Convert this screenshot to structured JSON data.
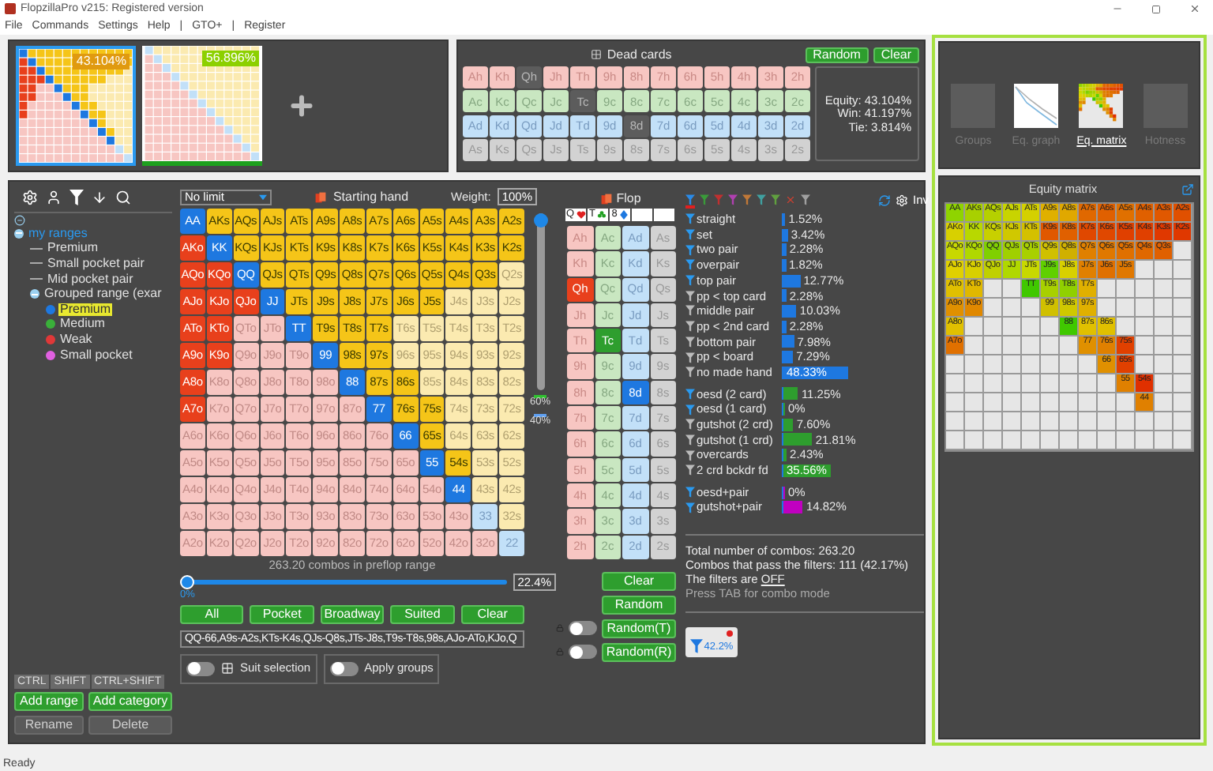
{
  "window": {
    "title": "FlopzillaPro v215: Registered version"
  },
  "menu": [
    "File",
    "Commands",
    "Settings",
    "Help",
    "|",
    "GTO+",
    "|",
    "Register"
  ],
  "ranges": [
    {
      "equity": "43.104%",
      "selected": true,
      "color": "#e09a10"
    },
    {
      "equity": "56.896%",
      "selected": false,
      "color": "#8cd000"
    }
  ],
  "dead_cards": {
    "title": "Dead cards",
    "buttons": [
      "Random",
      "Clear"
    ],
    "rows": [
      [
        {
          "label": "Ah",
          "disabled": false
        },
        {
          "label": "Kh",
          "disabled": false
        },
        {
          "label": "Qh",
          "disabled": true
        },
        {
          "label": "Jh",
          "disabled": false
        },
        {
          "label": "Th",
          "disabled": false
        },
        {
          "label": "9h",
          "disabled": false
        },
        {
          "label": "8h",
          "disabled": false
        },
        {
          "label": "7h",
          "disabled": false
        },
        {
          "label": "6h",
          "disabled": false
        },
        {
          "label": "5h",
          "disabled": false
        },
        {
          "label": "4h",
          "disabled": false
        },
        {
          "label": "3h",
          "disabled": false
        },
        {
          "label": "2h",
          "disabled": false
        }
      ],
      [
        {
          "label": "Ac",
          "disabled": false
        },
        {
          "label": "Kc",
          "disabled": false
        },
        {
          "label": "Qc",
          "disabled": false
        },
        {
          "label": "Jc",
          "disabled": false
        },
        {
          "label": "Tc",
          "disabled": true
        },
        {
          "label": "9c",
          "disabled": false
        },
        {
          "label": "8c",
          "disabled": false
        },
        {
          "label": "7c",
          "disabled": false
        },
        {
          "label": "6c",
          "disabled": false
        },
        {
          "label": "5c",
          "disabled": false
        },
        {
          "label": "4c",
          "disabled": false
        },
        {
          "label": "3c",
          "disabled": false
        },
        {
          "label": "2c",
          "disabled": false
        }
      ],
      [
        {
          "label": "Ad",
          "disabled": false
        },
        {
          "label": "Kd",
          "disabled": false
        },
        {
          "label": "Qd",
          "disabled": false
        },
        {
          "label": "Jd",
          "disabled": false
        },
        {
          "label": "Td",
          "disabled": false
        },
        {
          "label": "9d",
          "disabled": false
        },
        {
          "label": "8d",
          "disabled": true
        },
        {
          "label": "7d",
          "disabled": false
        },
        {
          "label": "6d",
          "disabled": false
        },
        {
          "label": "5d",
          "disabled": false
        },
        {
          "label": "4d",
          "disabled": false
        },
        {
          "label": "3d",
          "disabled": false
        },
        {
          "label": "2d",
          "disabled": false
        }
      ],
      [
        {
          "label": "As",
          "disabled": false
        },
        {
          "label": "Ks",
          "disabled": false
        },
        {
          "label": "Qs",
          "disabled": false
        },
        {
          "label": "Js",
          "disabled": false
        },
        {
          "label": "Ts",
          "disabled": false
        },
        {
          "label": "9s",
          "disabled": false
        },
        {
          "label": "8s",
          "disabled": false
        },
        {
          "label": "7s",
          "disabled": false
        },
        {
          "label": "6s",
          "disabled": false
        },
        {
          "label": "5s",
          "disabled": false
        },
        {
          "label": "4s",
          "disabled": false
        },
        {
          "label": "3s",
          "disabled": false
        },
        {
          "label": "2s",
          "disabled": false
        }
      ]
    ],
    "equity": [
      "Equity: 43.104%",
      "Win: 41.197%",
      "Tie: 3.814%"
    ]
  },
  "views": [
    {
      "label": "Groups",
      "selected": false,
      "kind": "empty"
    },
    {
      "label": "Eq. graph",
      "selected": false,
      "kind": "graph"
    },
    {
      "label": "Eq. matrix",
      "selected": true,
      "kind": "matrix"
    },
    {
      "label": "Hotness",
      "selected": false,
      "kind": "empty"
    }
  ],
  "tree": [
    {
      "label": "my ranges",
      "expanded": true,
      "selected": false,
      "children": [
        {
          "label": "Premium",
          "selected": false
        },
        {
          "label": "Small pocket pair",
          "selected": false
        },
        {
          "label": "Mid pocket pair",
          "selected": false
        },
        {
          "label": "Grouped range (exar",
          "expanded": true,
          "selected": false,
          "children": [
            {
              "label": "Premium",
              "selected": true,
              "color": "#1e78e0"
            },
            {
              "label": "Medium",
              "selected": false,
              "color": "#3ab03a"
            },
            {
              "label": "Weak",
              "selected": false,
              "color": "#e03838"
            },
            {
              "label": "Small pocket",
              "selected": false,
              "color": "#e060e0"
            }
          ]
        }
      ]
    }
  ],
  "modifier_tabs": [
    {
      "label": "CTRL",
      "selected": false
    },
    {
      "label": "SHIFT",
      "selected": false
    },
    {
      "label": "CTRL+SHIFT",
      "selected": false
    }
  ],
  "tree_buttons": [
    {
      "label": "Add range",
      "disabled": false
    },
    {
      "label": "Add category",
      "disabled": false
    },
    {
      "label": "Rename",
      "disabled": true
    },
    {
      "label": "Delete",
      "disabled": true
    }
  ],
  "range_editor": {
    "game": "No limit",
    "title": "Starting hand",
    "weight_label": "Weight:",
    "weight": "100%",
    "weight_slider": {
      "level": 1
    },
    "legend": [
      "60%",
      "40%"
    ],
    "grid": [
      {
        "cells": [
          {
            "label": "AA",
            "selected": true
          },
          {
            "label": "AKs",
            "selected": true
          },
          {
            "label": "AQs",
            "selected": true
          },
          {
            "label": "AJs",
            "selected": true
          },
          {
            "label": "ATs",
            "selected": true
          },
          {
            "label": "A9s",
            "selected": true
          },
          {
            "label": "A8s",
            "selected": true
          },
          {
            "label": "A7s",
            "selected": true
          },
          {
            "label": "A6s",
            "selected": true
          },
          {
            "label": "A5s",
            "selected": true
          },
          {
            "label": "A4s",
            "selected": true
          },
          {
            "label": "A3s",
            "selected": true
          },
          {
            "label": "A2s",
            "selected": true
          }
        ]
      },
      {
        "cells": [
          {
            "label": "AKo",
            "selected": true
          },
          {
            "label": "KK",
            "selected": true
          },
          {
            "label": "KQs",
            "selected": true
          },
          {
            "label": "KJs",
            "selected": true
          },
          {
            "label": "KTs",
            "selected": true
          },
          {
            "label": "K9s",
            "selected": true
          },
          {
            "label": "K8s",
            "selected": true
          },
          {
            "label": "K7s",
            "selected": true
          },
          {
            "label": "K6s",
            "selected": true
          },
          {
            "label": "K5s",
            "selected": true
          },
          {
            "label": "K4s",
            "selected": true
          },
          {
            "label": "K3s",
            "selected": true
          },
          {
            "label": "K2s",
            "selected": true
          }
        ]
      },
      {
        "cells": [
          {
            "label": "AQo",
            "selected": true
          },
          {
            "label": "KQo",
            "selected": true
          },
          {
            "label": "QQ",
            "selected": true
          },
          {
            "label": "QJs",
            "selected": true
          },
          {
            "label": "QTs",
            "selected": true
          },
          {
            "label": "Q9s",
            "selected": true
          },
          {
            "label": "Q8s",
            "selected": true
          },
          {
            "label": "Q7s",
            "selected": true
          },
          {
            "label": "Q6s",
            "selected": true
          },
          {
            "label": "Q5s",
            "selected": true
          },
          {
            "label": "Q4s",
            "selected": true
          },
          {
            "label": "Q3s",
            "selected": true
          },
          {
            "label": "Q2s",
            "selected": false
          }
        ]
      },
      {
        "cells": [
          {
            "label": "AJo",
            "selected": true
          },
          {
            "label": "KJo",
            "selected": true
          },
          {
            "label": "QJo",
            "selected": true
          },
          {
            "label": "JJ",
            "selected": true
          },
          {
            "label": "JTs",
            "selected": true
          },
          {
            "label": "J9s",
            "selected": true
          },
          {
            "label": "J8s",
            "selected": true
          },
          {
            "label": "J7s",
            "selected": true
          },
          {
            "label": "J6s",
            "selected": true
          },
          {
            "label": "J5s",
            "selected": true
          },
          {
            "label": "J4s",
            "selected": false
          },
          {
            "label": "J3s",
            "selected": false
          },
          {
            "label": "J2s",
            "selected": false
          }
        ]
      },
      {
        "cells": [
          {
            "label": "ATo",
            "selected": true
          },
          {
            "label": "KTo",
            "selected": true
          },
          {
            "label": "QTo",
            "selected": false
          },
          {
            "label": "JTo",
            "selected": false
          },
          {
            "label": "TT",
            "selected": true
          },
          {
            "label": "T9s",
            "selected": true
          },
          {
            "label": "T8s",
            "selected": true
          },
          {
            "label": "T7s",
            "selected": true
          },
          {
            "label": "T6s",
            "selected": false
          },
          {
            "label": "T5s",
            "selected": false
          },
          {
            "label": "T4s",
            "selected": false
          },
          {
            "label": "T3s",
            "selected": false
          },
          {
            "label": "T2s",
            "selected": false
          }
        ]
      },
      {
        "cells": [
          {
            "label": "A9o",
            "selected": true
          },
          {
            "label": "K9o",
            "selected": true
          },
          {
            "label": "Q9o",
            "selected": false
          },
          {
            "label": "J9o",
            "selected": false
          },
          {
            "label": "T9o",
            "selected": false
          },
          {
            "label": "99",
            "selected": true
          },
          {
            "label": "98s",
            "selected": true
          },
          {
            "label": "97s",
            "selected": true
          },
          {
            "label": "96s",
            "selected": false
          },
          {
            "label": "95s",
            "selected": false
          },
          {
            "label": "94s",
            "selected": false
          },
          {
            "label": "93s",
            "selected": false
          },
          {
            "label": "92s",
            "selected": false
          }
        ]
      },
      {
        "cells": [
          {
            "label": "A8o",
            "selected": true
          },
          {
            "label": "K8o",
            "selected": false
          },
          {
            "label": "Q8o",
            "selected": false
          },
          {
            "label": "J8o",
            "selected": false
          },
          {
            "label": "T8o",
            "selected": false
          },
          {
            "label": "98o",
            "selected": false
          },
          {
            "label": "88",
            "selected": true
          },
          {
            "label": "87s",
            "selected": true
          },
          {
            "label": "86s",
            "selected": true
          },
          {
            "label": "85s",
            "selected": false
          },
          {
            "label": "84s",
            "selected": false
          },
          {
            "label": "83s",
            "selected": false
          },
          {
            "label": "82s",
            "selected": false
          }
        ]
      },
      {
        "cells": [
          {
            "label": "A7o",
            "selected": true
          },
          {
            "label": "K7o",
            "selected": false
          },
          {
            "label": "Q7o",
            "selected": false
          },
          {
            "label": "J7o",
            "selected": false
          },
          {
            "label": "T7o",
            "selected": false
          },
          {
            "label": "97o",
            "selected": false
          },
          {
            "label": "87o",
            "selected": false
          },
          {
            "label": "77",
            "selected": true
          },
          {
            "label": "76s",
            "selected": true
          },
          {
            "label": "75s",
            "selected": true
          },
          {
            "label": "74s",
            "selected": false
          },
          {
            "label": "73s",
            "selected": false
          },
          {
            "label": "72s",
            "selected": false
          }
        ]
      },
      {
        "cells": [
          {
            "label": "A6o",
            "selected": false
          },
          {
            "label": "K6o",
            "selected": false
          },
          {
            "label": "Q6o",
            "selected": false
          },
          {
            "label": "J6o",
            "selected": false
          },
          {
            "label": "T6o",
            "selected": false
          },
          {
            "label": "96o",
            "selected": false
          },
          {
            "label": "86o",
            "selected": false
          },
          {
            "label": "76o",
            "selected": false
          },
          {
            "label": "66",
            "selected": true
          },
          {
            "label": "65s",
            "selected": true
          },
          {
            "label": "64s",
            "selected": false
          },
          {
            "label": "63s",
            "selected": false
          },
          {
            "label": "62s",
            "selected": false
          }
        ]
      },
      {
        "cells": [
          {
            "label": "A5o",
            "selected": false
          },
          {
            "label": "K5o",
            "selected": false
          },
          {
            "label": "Q5o",
            "selected": false
          },
          {
            "label": "J5o",
            "selected": false
          },
          {
            "label": "T5o",
            "selected": false
          },
          {
            "label": "95o",
            "selected": false
          },
          {
            "label": "85o",
            "selected": false
          },
          {
            "label": "75o",
            "selected": false
          },
          {
            "label": "65o",
            "selected": false
          },
          {
            "label": "55",
            "selected": true
          },
          {
            "label": "54s",
            "selected": true
          },
          {
            "label": "53s",
            "selected": false
          },
          {
            "label": "52s",
            "selected": false
          }
        ]
      },
      {
        "cells": [
          {
            "label": "A4o",
            "selected": false
          },
          {
            "label": "K4o",
            "selected": false
          },
          {
            "label": "Q4o",
            "selected": false
          },
          {
            "label": "J4o",
            "selected": false
          },
          {
            "label": "T4o",
            "selected": false
          },
          {
            "label": "94o",
            "selected": false
          },
          {
            "label": "84o",
            "selected": false
          },
          {
            "label": "74o",
            "selected": false
          },
          {
            "label": "64o",
            "selected": false
          },
          {
            "label": "54o",
            "selected": false
          },
          {
            "label": "44",
            "selected": true
          },
          {
            "label": "43s",
            "selected": false
          },
          {
            "label": "42s",
            "selected": false
          }
        ]
      },
      {
        "cells": [
          {
            "label": "A3o",
            "selected": false
          },
          {
            "label": "K3o",
            "selected": false
          },
          {
            "label": "Q3o",
            "selected": false
          },
          {
            "label": "J3o",
            "selected": false
          },
          {
            "label": "T3o",
            "selected": false
          },
          {
            "label": "93o",
            "selected": false
          },
          {
            "label": "83o",
            "selected": false
          },
          {
            "label": "73o",
            "selected": false
          },
          {
            "label": "63o",
            "selected": false
          },
          {
            "label": "53o",
            "selected": false
          },
          {
            "label": "43o",
            "selected": false
          },
          {
            "label": "33",
            "selected": false
          },
          {
            "label": "32s",
            "selected": false
          }
        ]
      },
      {
        "cells": [
          {
            "label": "A2o",
            "selected": false
          },
          {
            "label": "K2o",
            "selected": false
          },
          {
            "label": "Q2o",
            "selected": false
          },
          {
            "label": "J2o",
            "selected": false
          },
          {
            "label": "T2o",
            "selected": false
          },
          {
            "label": "92o",
            "selected": false
          },
          {
            "label": "82o",
            "selected": false
          },
          {
            "label": "72o",
            "selected": false
          },
          {
            "label": "62o",
            "selected": false
          },
          {
            "label": "52o",
            "selected": false
          },
          {
            "label": "42o",
            "selected": false
          },
          {
            "label": "32o",
            "selected": false
          },
          {
            "label": "22",
            "selected": false
          }
        ]
      }
    ],
    "combos": "263.20 combos in preflop range",
    "range_slider": {
      "level": 0,
      "min_label": "0%",
      "value": "22.4%"
    },
    "buttons": [
      "All",
      "Pocket",
      "Broadway",
      "Suited",
      "Clear"
    ],
    "range_text": "QQ-66,A9s-A2s,KTs-K4s,QJs-Q8s,JTs-J8s,T9s-T8s,98s,AJo-ATo,KJo,Q",
    "toggles": [
      {
        "label": "Suit selection",
        "on": false,
        "kind": "suits"
      },
      {
        "label": "Apply groups",
        "on": false,
        "kind": "plain"
      }
    ]
  },
  "flop": {
    "title": "Flop",
    "board": [
      {
        "kind": "heart",
        "rank": "Q"
      },
      {
        "kind": "club",
        "rank": "T"
      },
      {
        "kind": "diamond",
        "rank": "8"
      },
      {
        "kind": "empty"
      },
      {
        "kind": "empty"
      }
    ],
    "rows": [
      [
        {
          "label": "Ah",
          "selected": false
        },
        {
          "label": "Ac",
          "selected": false
        },
        {
          "label": "Ad",
          "selected": false
        },
        {
          "label": "As",
          "selected": false
        }
      ],
      [
        {
          "label": "Kh",
          "selected": false
        },
        {
          "label": "Kc",
          "selected": false
        },
        {
          "label": "Kd",
          "selected": false
        },
        {
          "label": "Ks",
          "selected": false
        }
      ],
      [
        {
          "label": "Qh",
          "selected": true
        },
        {
          "label": "Qc",
          "selected": false
        },
        {
          "label": "Qd",
          "selected": false
        },
        {
          "label": "Qs",
          "selected": false
        }
      ],
      [
        {
          "label": "Jh",
          "selected": false
        },
        {
          "label": "Jc",
          "selected": false
        },
        {
          "label": "Jd",
          "selected": false
        },
        {
          "label": "Js",
          "selected": false
        }
      ],
      [
        {
          "label": "Th",
          "selected": false
        },
        {
          "label": "Tc",
          "selected": true
        },
        {
          "label": "Td",
          "selected": false
        },
        {
          "label": "Ts",
          "selected": false
        }
      ],
      [
        {
          "label": "9h",
          "selected": false
        },
        {
          "label": "9c",
          "selected": false
        },
        {
          "label": "9d",
          "selected": false
        },
        {
          "label": "9s",
          "selected": false
        }
      ],
      [
        {
          "label": "8h",
          "selected": false
        },
        {
          "label": "8c",
          "selected": false
        },
        {
          "label": "8d",
          "selected": true
        },
        {
          "label": "8s",
          "selected": false
        }
      ],
      [
        {
          "label": "7h",
          "selected": false
        },
        {
          "label": "7c",
          "selected": false
        },
        {
          "label": "7d",
          "selected": false
        },
        {
          "label": "7s",
          "selected": false
        }
      ],
      [
        {
          "label": "6h",
          "selected": false
        },
        {
          "label": "6c",
          "selected": false
        },
        {
          "label": "6d",
          "selected": false
        },
        {
          "label": "6s",
          "selected": false
        }
      ],
      [
        {
          "label": "5h",
          "selected": false
        },
        {
          "label": "5c",
          "selected": false
        },
        {
          "label": "5d",
          "selected": false
        },
        {
          "label": "5s",
          "selected": false
        }
      ],
      [
        {
          "label": "4h",
          "selected": false
        },
        {
          "label": "4c",
          "selected": false
        },
        {
          "label": "4d",
          "selected": false
        },
        {
          "label": "4s",
          "selected": false
        }
      ],
      [
        {
          "label": "3h",
          "selected": false
        },
        {
          "label": "3c",
          "selected": false
        },
        {
          "label": "3d",
          "selected": false
        },
        {
          "label": "3s",
          "selected": false
        }
      ],
      [
        {
          "label": "2h",
          "selected": false
        },
        {
          "label": "2c",
          "selected": false
        },
        {
          "label": "2d",
          "selected": false
        },
        {
          "label": "2s",
          "selected": false
        }
      ]
    ],
    "buttons": [
      {
        "label": "Clear",
        "kind": "plain"
      },
      {
        "label": "Random",
        "kind": "plain"
      },
      {
        "label": "Random(T)",
        "kind": "toggle",
        "on": false
      },
      {
        "label": "Random(R)",
        "kind": "toggle",
        "on": false
      }
    ]
  },
  "filters": {
    "inv": "Inv",
    "tabs": [
      {
        "kind": "funnel",
        "color": "#2a8ae8",
        "selected": true
      },
      {
        "kind": "funnel",
        "color": "#3a9a3a",
        "selected": false
      },
      {
        "kind": "funnel",
        "color": "#c03030",
        "selected": false
      },
      {
        "kind": "funnel",
        "color": "#b040b0",
        "selected": false
      },
      {
        "kind": "funnel",
        "color": "#c07838",
        "selected": false
      },
      {
        "kind": "funnel",
        "color": "#40a0a0",
        "selected": false
      },
      {
        "kind": "funnel",
        "color": "#60a040",
        "selected": false
      },
      {
        "kind": "clear",
        "color": "#d04030",
        "selected": false
      },
      {
        "kind": "funnel",
        "color": "#a0a0a0",
        "selected": false
      }
    ],
    "groups": [
      [
        {
          "label": "straight",
          "value": "1.52%",
          "level": 0.0152,
          "active": true,
          "color": "#1e78e0"
        },
        {
          "label": "set",
          "value": "3.42%",
          "level": 0.0342,
          "active": true,
          "color": "#1e78e0"
        },
        {
          "label": "two pair",
          "value": "2.28%",
          "level": 0.0228,
          "active": true,
          "color": "#1e78e0"
        },
        {
          "label": "overpair",
          "value": "1.82%",
          "level": 0.0182,
          "active": true,
          "color": "#1e78e0"
        },
        {
          "label": "top pair",
          "value": "12.77%",
          "level": 0.1277,
          "active": true,
          "color": "#1e78e0"
        },
        {
          "label": "pp < top card",
          "value": "2.28%",
          "level": 0.0228,
          "active": false,
          "color": "#1e78e0"
        },
        {
          "label": "middle pair",
          "value": "10.03%",
          "level": 0.1003,
          "active": false,
          "color": "#1e78e0"
        },
        {
          "label": "pp < 2nd card",
          "value": "2.28%",
          "level": 0.0228,
          "active": false,
          "color": "#1e78e0"
        },
        {
          "label": "bottom pair",
          "value": "7.98%",
          "level": 0.0798,
          "active": false,
          "color": "#1e78e0"
        },
        {
          "label": "pp < board",
          "value": "7.29%",
          "level": 0.0729,
          "active": false,
          "color": "#1e78e0"
        },
        {
          "label": "no made hand",
          "value": "48.33%",
          "level": 0.4833,
          "active": false,
          "color": "#1e78e0"
        }
      ],
      [
        {
          "label": "oesd (2 card)",
          "value": "11.25%",
          "level": 0.1125,
          "active": true,
          "color": "#2e9e2e"
        },
        {
          "label": "oesd (1 card)",
          "value": "0%",
          "level": 0,
          "active": true,
          "color": "#2e9e2e"
        },
        {
          "label": "gutshot (2 crd)",
          "value": "7.60%",
          "level": 0.076,
          "active": false,
          "color": "#2e9e2e"
        },
        {
          "label": "gutshot (1 crd)",
          "value": "21.81%",
          "level": 0.2181,
          "active": false,
          "color": "#2e9e2e"
        },
        {
          "label": "overcards",
          "value": "2.43%",
          "level": 0.0243,
          "active": false,
          "color": "#2e9e2e"
        },
        {
          "label": "2 crd bckdr fd",
          "value": "35.56%",
          "level": 0.3556,
          "active": false,
          "color": "#2e9e2e"
        }
      ],
      [
        {
          "label": "oesd+pair",
          "value": "0%",
          "level": 0,
          "active": true,
          "color": "#c000c0"
        },
        {
          "label": "gutshot+pair",
          "value": "14.82%",
          "level": 0.1482,
          "active": true,
          "color": "#c000c0"
        }
      ]
    ],
    "stats": [
      "Total number of combos: 263.20",
      "Combos that pass the filters: 111 (42.17%)"
    ],
    "state_label": "The filters are",
    "state": "OFF",
    "hint": "Press TAB for combo mode",
    "badge": "42.2%"
  },
  "equity_matrix": {
    "title": "Equity matrix",
    "rows": [
      [
        {
          "label": "AA",
          "color": "#8fd400"
        },
        {
          "label": "AKs",
          "color": "#a8d000"
        },
        {
          "label": "AQs",
          "color": "#b5d000"
        },
        {
          "label": "AJs",
          "color": "#c8d400"
        },
        {
          "label": "ATs",
          "color": "#d4d000"
        },
        {
          "label": "A9s",
          "color": "#e0b000"
        },
        {
          "label": "A8s",
          "color": "#e0a800"
        },
        {
          "label": "A7s",
          "color": "#e06800"
        },
        {
          "label": "A6s",
          "color": "#e06000"
        },
        {
          "label": "A5s",
          "color": "#e07000"
        },
        {
          "label": "A4s",
          "color": "#e06000"
        },
        {
          "label": "A3s",
          "color": "#e05800"
        },
        {
          "label": "A2s",
          "color": "#e05000"
        }
      ],
      [
        {
          "label": "AKo",
          "color": "#d8d000"
        },
        {
          "label": "KK",
          "color": "#b8d800"
        },
        {
          "label": "KQs",
          "color": "#c8d000"
        },
        {
          "label": "KJs",
          "color": "#d0c800"
        },
        {
          "label": "KTs",
          "color": "#d4c000"
        },
        {
          "label": "K9s",
          "color": "#e05800"
        },
        {
          "label": "K8s",
          "color": "#e06000"
        },
        {
          "label": "K7s",
          "color": "#e04800"
        },
        {
          "label": "K6s",
          "color": "#e04800"
        },
        {
          "label": "K5s",
          "color": "#e04000"
        },
        {
          "label": "K4s",
          "color": "#e04000"
        },
        {
          "label": "K3s",
          "color": "#e03800"
        },
        {
          "label": "K2s",
          "color": "#e03800"
        }
      ],
      [
        {
          "label": "AQo",
          "color": "#c8d800"
        },
        {
          "label": "KQo",
          "color": "#b0d800"
        },
        {
          "label": "QQ",
          "color": "#80d000"
        },
        {
          "label": "QJs",
          "color": "#a0d000"
        },
        {
          "label": "QTs",
          "color": "#a8d000"
        },
        {
          "label": "Q9s",
          "color": "#d0c000"
        },
        {
          "label": "Q8s",
          "color": "#d0b000"
        },
        {
          "label": "Q7s",
          "color": "#e08000"
        },
        {
          "label": "Q6s",
          "color": "#e07800"
        },
        {
          "label": "Q5s",
          "color": "#e07000"
        },
        {
          "label": "Q4s",
          "color": "#e06800"
        },
        {
          "label": "Q3s",
          "color": "#e06000"
        },
        null
      ],
      [
        {
          "label": "AJo",
          "color": "#e0d000"
        },
        {
          "label": "KJo",
          "color": "#d8d000"
        },
        {
          "label": "QJo",
          "color": "#c0d000"
        },
        {
          "label": "JJ",
          "color": "#b0d800"
        },
        {
          "label": "JTs",
          "color": "#c8d800"
        },
        {
          "label": "J9s",
          "color": "#60d000"
        },
        {
          "label": "J8s",
          "color": "#d8d000"
        },
        {
          "label": "J7s",
          "color": "#e08000"
        },
        {
          "label": "J6s",
          "color": "#e07000"
        },
        {
          "label": "J5s",
          "color": "#e07800"
        },
        null,
        null,
        null
      ],
      [
        {
          "label": "ATo",
          "color": "#e0c000"
        },
        {
          "label": "KTo",
          "color": "#e0b800"
        },
        null,
        null,
        {
          "label": "TT",
          "color": "#40c800"
        },
        {
          "label": "T9s",
          "color": "#a8d000"
        },
        {
          "label": "T8s",
          "color": "#90d000"
        },
        {
          "label": "T7s",
          "color": "#e0b000"
        },
        null,
        null,
        null,
        null,
        null
      ],
      [
        {
          "label": "A9o",
          "color": "#e09000"
        },
        {
          "label": "K9o",
          "color": "#e08800"
        },
        null,
        null,
        null,
        {
          "label": "99",
          "color": "#d0c000"
        },
        {
          "label": "98s",
          "color": "#d0c800"
        },
        {
          "label": "97s",
          "color": "#e0b000"
        },
        null,
        null,
        null,
        null,
        null
      ],
      [
        {
          "label": "A8o",
          "color": "#e0c000"
        },
        null,
        null,
        null,
        null,
        null,
        {
          "label": "88",
          "color": "#40c800"
        },
        {
          "label": "87s",
          "color": "#e0c000"
        },
        {
          "label": "86s",
          "color": "#e0c000"
        },
        null,
        null,
        null,
        null
      ],
      [
        {
          "label": "A7o",
          "color": "#e07000"
        },
        null,
        null,
        null,
        null,
        null,
        null,
        {
          "label": "77",
          "color": "#e09000"
        },
        {
          "label": "76s",
          "color": "#e08000"
        },
        {
          "label": "75s",
          "color": "#e04000"
        },
        null,
        null,
        null
      ],
      [
        null,
        null,
        null,
        null,
        null,
        null,
        null,
        null,
        {
          "label": "66",
          "color": "#e09000"
        },
        {
          "label": "65s",
          "color": "#e04000"
        },
        null,
        null,
        null
      ],
      [
        null,
        null,
        null,
        null,
        null,
        null,
        null,
        null,
        null,
        {
          "label": "55",
          "color": "#e08000"
        },
        {
          "label": "54s",
          "color": "#e03000"
        },
        null,
        null
      ],
      [
        null,
        null,
        null,
        null,
        null,
        null,
        null,
        null,
        null,
        null,
        {
          "label": "44",
          "color": "#e08000"
        },
        null,
        null
      ],
      [
        null,
        null,
        null,
        null,
        null,
        null,
        null,
        null,
        null,
        null,
        null,
        null,
        null
      ],
      [
        null,
        null,
        null,
        null,
        null,
        null,
        null,
        null,
        null,
        null,
        null,
        null,
        null
      ]
    ]
  },
  "status_bar": "Ready"
}
